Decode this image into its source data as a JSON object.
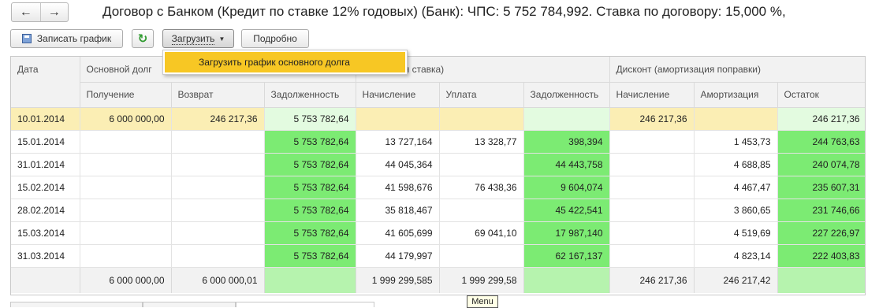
{
  "nav": {
    "back_glyph": "←",
    "forward_glyph": "→",
    "back_icon": "arrow-left-icon",
    "forward_icon": "arrow-right-icon"
  },
  "title": "Договор с Банком (Кредит по ставке 12% годовых) (Банк): ЧПС: 5 752 784,992. Ставка по договору: 15,000 %,",
  "toolbar": {
    "save_label": "Записать график",
    "refresh_glyph": "↻",
    "load_label": "Загрузить",
    "detail_label": "Подробно"
  },
  "dropdown": {
    "item_label": "Загрузить график основного долга"
  },
  "grid": {
    "group_headers": {
      "date": "Дата",
      "principal": "Основной долг",
      "market": "(Рыночная ставка)",
      "discount": "Дисконт (амортизация поправки)"
    },
    "sub_headers": [
      "Получение",
      "Возврат",
      "Задолженность",
      "Начисление",
      "Уплата",
      "Задолженность",
      "Начисление",
      "Амортизация",
      "Остаток"
    ],
    "rows": [
      [
        "10.01.2014",
        "6 000 000,00",
        "246 217,36",
        "5 753 782,64",
        "",
        "",
        "",
        "246 217,36",
        "",
        "246 217,36"
      ],
      [
        "15.01.2014",
        "",
        "",
        "5 753 782,64",
        "13 727,164",
        "13 328,77",
        "398,394",
        "",
        "1 453,73",
        "244 763,63"
      ],
      [
        "31.01.2014",
        "",
        "",
        "5 753 782,64",
        "44 045,364",
        "",
        "44 443,758",
        "",
        "4 688,85",
        "240 074,78"
      ],
      [
        "15.02.2014",
        "",
        "",
        "5 753 782,64",
        "41 598,676",
        "76 438,36",
        "9 604,074",
        "",
        "4 467,47",
        "235 607,31"
      ],
      [
        "28.02.2014",
        "",
        "",
        "5 753 782,64",
        "35 818,467",
        "",
        "45 422,541",
        "",
        "3 860,65",
        "231 746,66"
      ],
      [
        "15.03.2014",
        "",
        "",
        "5 753 782,64",
        "41 605,699",
        "69 041,10",
        "17 987,140",
        "",
        "4 519,69",
        "227 226,97"
      ],
      [
        "31.03.2014",
        "",
        "",
        "5 753 782,64",
        "44 179,997",
        "",
        "62 167,137",
        "",
        "4 823,14",
        "222 403,83"
      ]
    ],
    "footer": [
      "",
      "6 000 000,00",
      "6 000 000,01",
      "",
      "1 999 299,585",
      "1 999 299,58",
      "",
      "246 217,36",
      "246 217,42",
      ""
    ]
  },
  "tooltip": "Menu",
  "colors": {
    "highlight": "#f7c724",
    "selected_row": "#fbeeb4",
    "green_cell": "#7ceb73"
  }
}
